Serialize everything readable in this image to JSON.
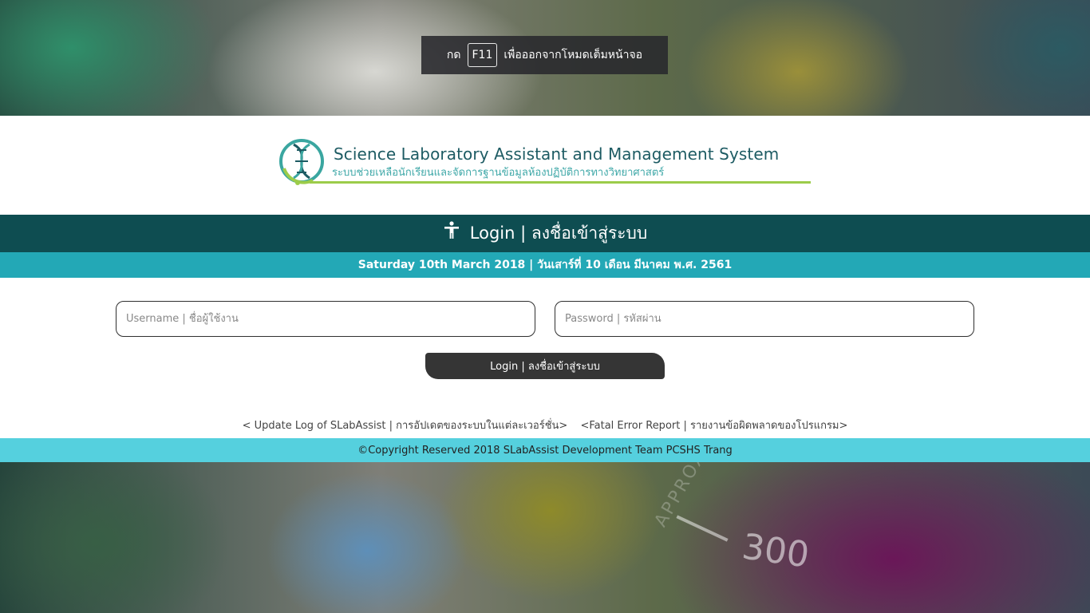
{
  "fullscreen_notice": {
    "prefix": "กด",
    "key": "F11",
    "suffix": "เพื่อออกจากโหมดเต็มหน้าจอ"
  },
  "logo": {
    "title": "Science Laboratory Assistant and Management System",
    "subtitle": "ระบบช่วยเหลือนักเรียนและจัดการฐานข้อมูลห้องปฏิบัติการทางวิทยาศาสตร์",
    "icon": "dna-flask-logo-icon"
  },
  "header": {
    "icon": "person-icon",
    "title": "Login | ลงชื่อเข้าสู่ระบบ"
  },
  "date_bar": {
    "text": "Saturday 10th March 2018 | วันเสาร์ที่ 10 เดือน มีนาคม พ.ศ. 2561"
  },
  "form": {
    "username_placeholder": "Username | ชื่อผู้ใช้งาน",
    "password_placeholder": "Password | รหัสผ่าน",
    "login_button": "Login | ลงชื่อเข้าสู่ระบบ"
  },
  "links": {
    "update_log": "< Update Log of SLabAssist | การอัปเดตของระบบในแต่ละเวอร์ชั่น>",
    "fatal_error": "<Fatal Error Report | รายงานข้อผิดพลาดของโปรแกรม>"
  },
  "footer": {
    "copyright": "©Copyright Reserved 2018 SLabAssist Development Team PCSHS Trang"
  },
  "background": {
    "measure_label": "300",
    "vertical_label": "APPROX"
  },
  "colors": {
    "header_bg": "#0e4d51",
    "date_bar_bg": "#23a8b6",
    "footer_bg": "#55d0de",
    "button_bg": "#353535",
    "logo_title": "#1d5b63",
    "logo_accent": "#9ccc4a"
  }
}
